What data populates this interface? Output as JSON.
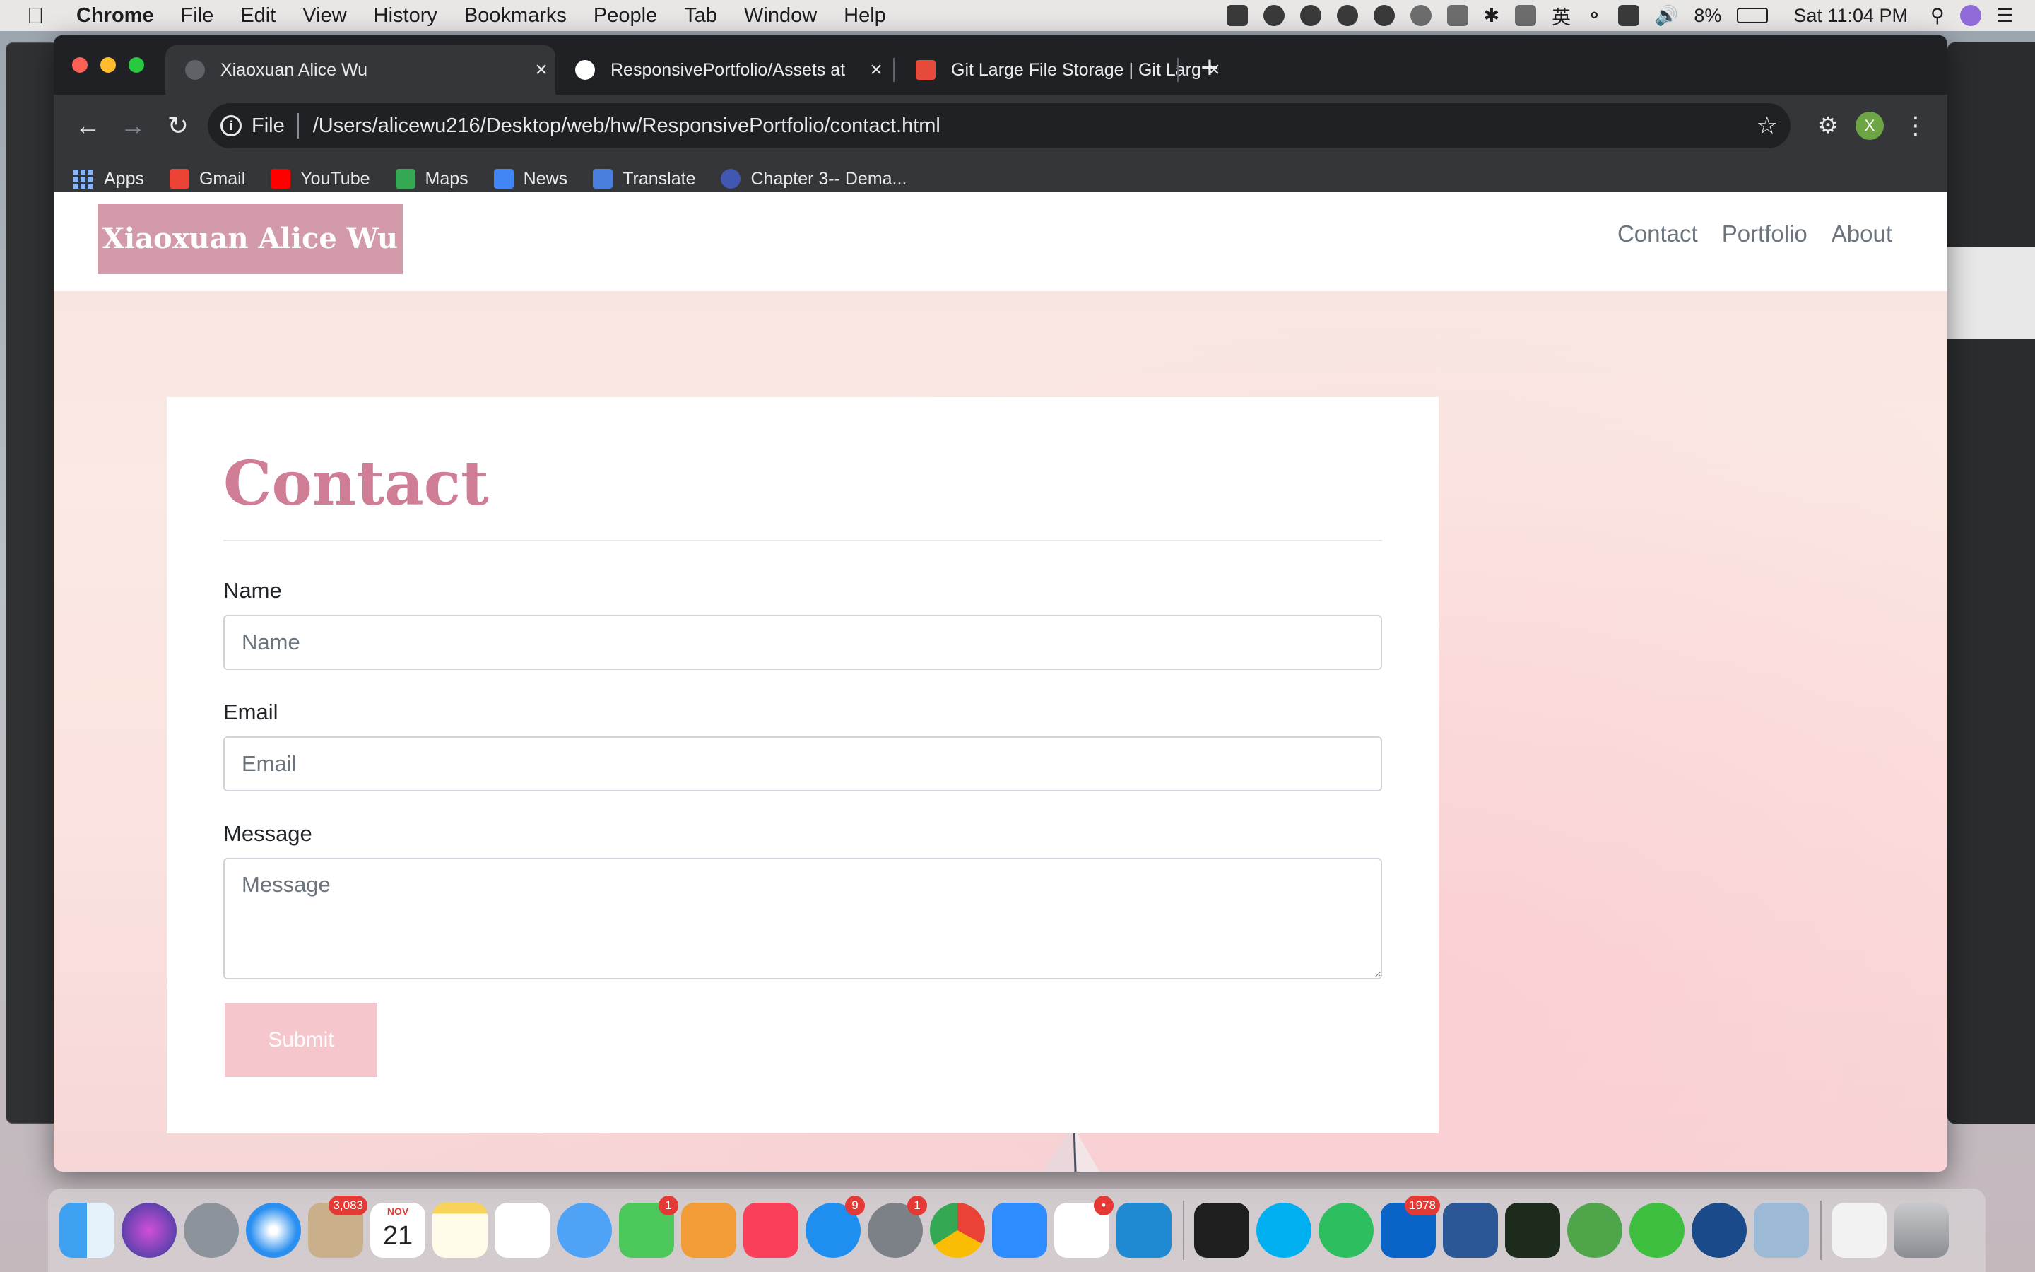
{
  "menubar": {
    "app_name": "Chrome",
    "items": [
      "File",
      "Edit",
      "View",
      "History",
      "Bookmarks",
      "People",
      "Tab",
      "Window",
      "Help"
    ],
    "battery": "8%",
    "clock": "Sat 11:04 PM",
    "input_method": "英"
  },
  "browser": {
    "tabs": [
      {
        "title": "Xiaoxuan Alice Wu",
        "active": true
      },
      {
        "title": "ResponsivePortfolio/Assets at",
        "active": false
      },
      {
        "title": "Git Large File Storage | Git Larg",
        "active": false
      }
    ],
    "address": {
      "scheme": "File",
      "url": "/Users/alicewu216/Desktop/web/hw/ResponsivePortfolio/contact.html"
    },
    "profile_initial": "X",
    "bookmarks": [
      "Apps",
      "Gmail",
      "YouTube",
      "Maps",
      "News",
      "Translate",
      "Chapter 3-- Dema..."
    ]
  },
  "site": {
    "brand": "Xiaoxuan Alice Wu",
    "nav": [
      "Contact",
      "Portfolio",
      "About"
    ],
    "heading": "Contact",
    "form": {
      "name_label": "Name",
      "name_placeholder": "Name",
      "email_label": "Email",
      "email_placeholder": "Email",
      "message_label": "Message",
      "message_placeholder": "Message",
      "submit_label": "Submit"
    }
  },
  "dock": {
    "calendar_month": "NOV",
    "calendar_day": "21",
    "badges": {
      "mail": "3,083",
      "facetime": "1",
      "appstore": "9",
      "settings": "1",
      "slack": "•",
      "outlook": "1978"
    }
  },
  "colors": {
    "brand_bg": "#d39aa9",
    "heading": "#d07d96",
    "submit_bg": "#f5c6cb",
    "chrome_dark": "#202124",
    "chrome_toolbar": "#35363a"
  }
}
